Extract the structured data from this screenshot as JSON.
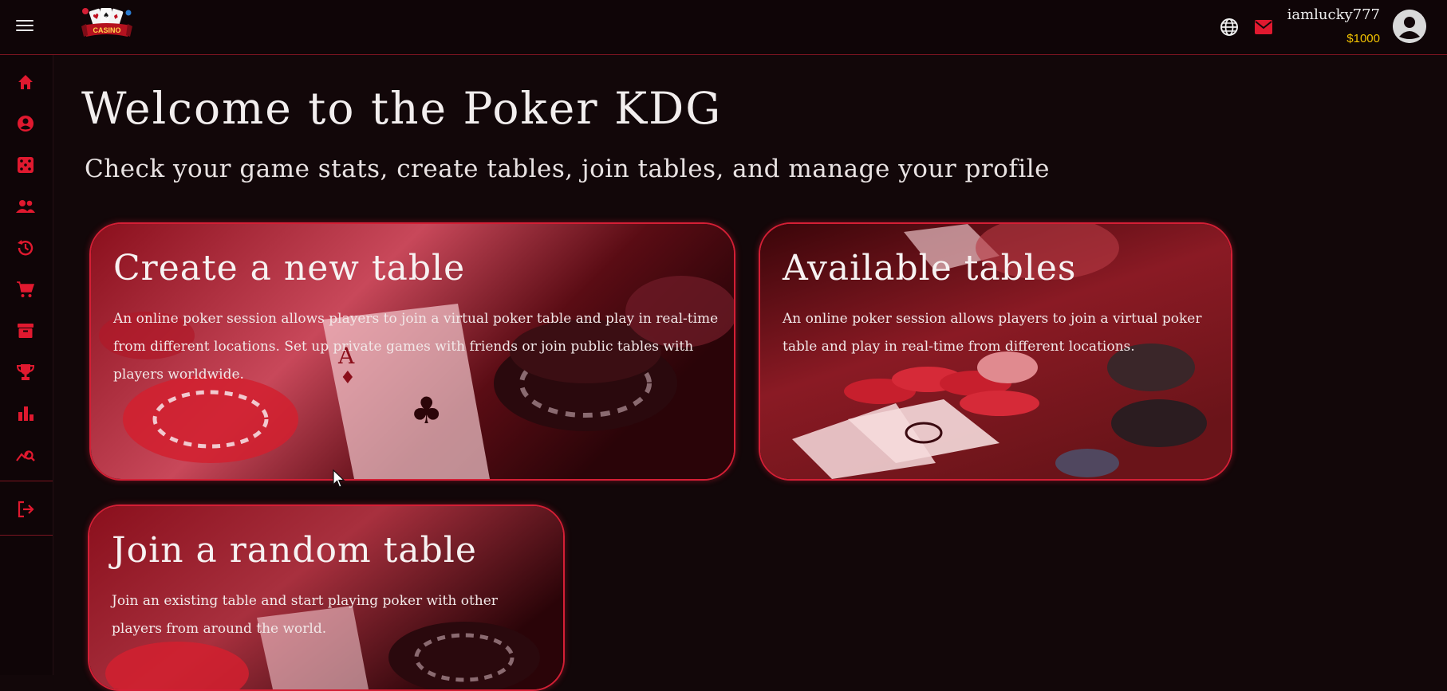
{
  "header": {
    "logo_text": "CASINO",
    "username": "iamlucky777",
    "balance": "$1000"
  },
  "sidebar": {
    "items": [
      {
        "icon": "home-icon"
      },
      {
        "icon": "account-circle-icon"
      },
      {
        "icon": "dice-icon"
      },
      {
        "icon": "people-icon"
      },
      {
        "icon": "history-icon"
      },
      {
        "icon": "cart-icon"
      },
      {
        "icon": "archive-icon"
      },
      {
        "icon": "trophy-icon"
      },
      {
        "icon": "bar-chart-icon"
      },
      {
        "icon": "query-stats-icon"
      }
    ],
    "logout_icon": "logout-icon"
  },
  "main": {
    "title": "Welcome to the Poker KDG",
    "subtitle": "Check your game stats, create tables, join tables, and manage your profile",
    "cards": [
      {
        "title": "Create a new table",
        "description": "An online poker session allows players to join a virtual poker table and play in real-time from different locations. Set up private games with friends or join public tables with players worldwide."
      },
      {
        "title": "Available tables",
        "description": "An online poker session allows players to join a virtual poker table and play in real-time from different locations."
      },
      {
        "title": "Join a random table",
        "description": "Join an existing table and start playing poker with other players from around the world."
      }
    ]
  },
  "colors": {
    "background": "#120709",
    "accent": "#d41f35",
    "balance": "#f2c200"
  }
}
